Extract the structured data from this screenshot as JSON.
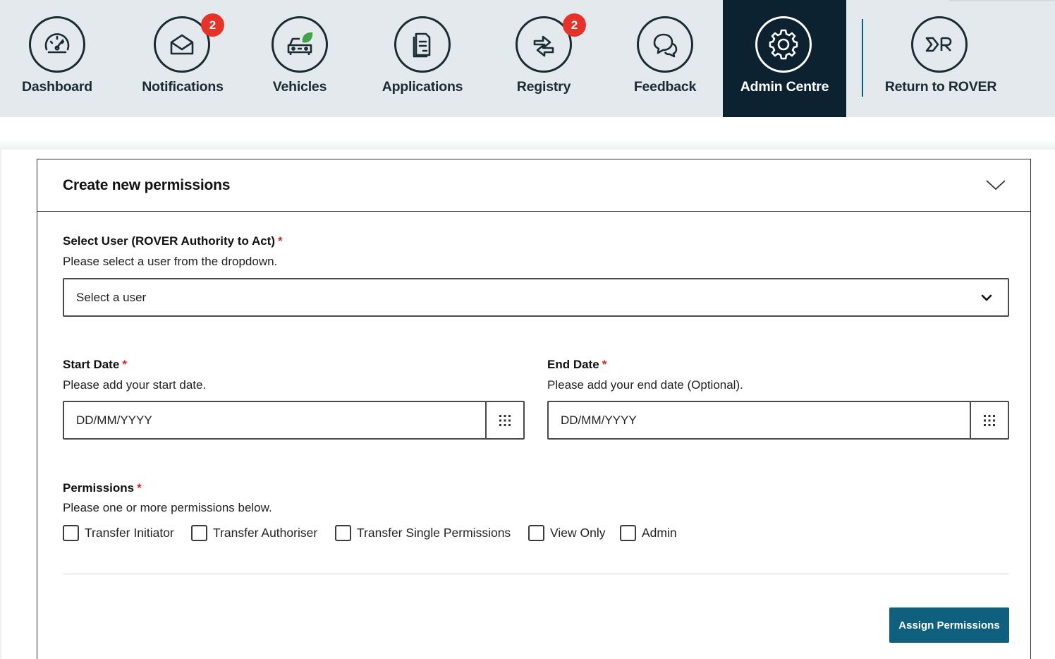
{
  "nav": {
    "items": [
      {
        "id": "dashboard",
        "label": "Dashboard",
        "icon": "speedometer-icon",
        "badge": ""
      },
      {
        "id": "notifications",
        "label": "Notifications",
        "icon": "envelope-icon",
        "badge": "2"
      },
      {
        "id": "vehicles",
        "label": "Vehicles",
        "icon": "eco-vehicle-icon",
        "badge": ""
      },
      {
        "id": "applications",
        "label": "Applications",
        "icon": "document-icon",
        "badge": ""
      },
      {
        "id": "registry",
        "label": "Registry",
        "icon": "transfer-arrows-icon",
        "badge": "2"
      },
      {
        "id": "feedback",
        "label": "Feedback",
        "icon": "chat-bubbles-icon",
        "badge": ""
      },
      {
        "id": "admin",
        "label": "Admin Centre",
        "icon": "gear-icon",
        "badge": "",
        "active": true
      },
      {
        "id": "rover",
        "label": "Return to ROVER",
        "icon": "rover-logo-icon",
        "badge": ""
      }
    ]
  },
  "panel": {
    "title": "Create new permissions",
    "user": {
      "label": "Select User (ROVER Authority to Act)",
      "required": "*",
      "hint": "Please select a user from the dropdown.",
      "value": "Select a user"
    },
    "start_date": {
      "label": "Start Date",
      "required": "*",
      "hint": "Please add your start date.",
      "placeholder": "DD/MM/YYYY"
    },
    "end_date": {
      "label": "End Date",
      "required": "*",
      "hint": "Please add your end date (Optional).",
      "placeholder": "DD/MM/YYYY"
    },
    "permissions": {
      "label": "Permissions",
      "required": "*",
      "hint": "Please one or more permissions below.",
      "options": [
        "Transfer Initiator",
        "Transfer Authoriser",
        "Transfer Single Permissions",
        "View Only",
        "Admin"
      ]
    },
    "submit_label": "Assign Permissions"
  },
  "colors": {
    "nav_bg": "#e3e9ec",
    "nav_active_bg": "#0d2230",
    "accent": "#0f5f7f",
    "badge": "#e5332a",
    "required": "#d8261c",
    "leaf": "#3fa548"
  }
}
